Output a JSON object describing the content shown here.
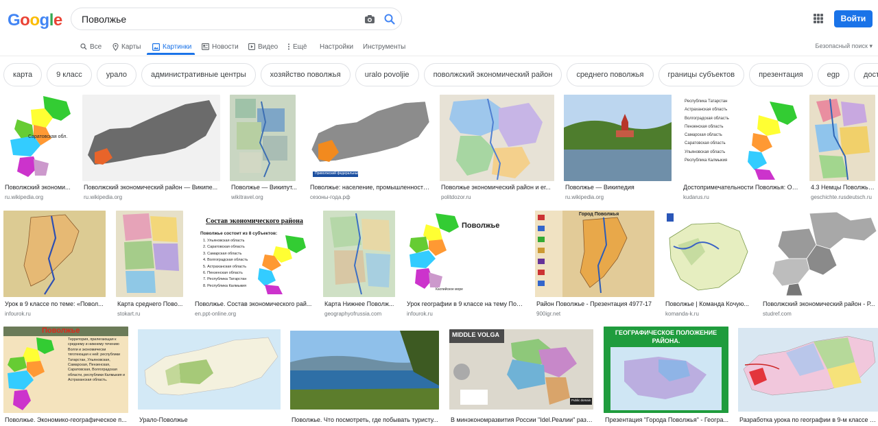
{
  "header": {
    "logo_letters": [
      "G",
      "o",
      "o",
      "g",
      "l",
      "e"
    ],
    "query": "Поволжье",
    "signin_label": "Войти"
  },
  "tabs": [
    {
      "label": "Все",
      "icon": "search-icon"
    },
    {
      "label": "Карты",
      "icon": "map-pin-icon"
    },
    {
      "label": "Картинки",
      "icon": "image-icon",
      "active": true
    },
    {
      "label": "Новости",
      "icon": "newspaper-icon"
    },
    {
      "label": "Видео",
      "icon": "play-icon"
    },
    {
      "label": "Ещё",
      "icon": "more-vert-icon"
    },
    {
      "label": "Настройки"
    },
    {
      "label": "Инструменты"
    }
  ],
  "safesearch_label": "Безопасный поиск ▾",
  "chips": [
    "карта",
    "9 класс",
    "урало",
    "административные центры",
    "хозяйство поволжья",
    "uralo povoljie",
    "поволжский экономический район",
    "среднего поволжья",
    "границы субъектов",
    "презентация",
    "egp",
    "достопримечатель"
  ],
  "results": [
    {
      "title": "Поволжский экономи...",
      "source": "ru.wikipedia.org"
    },
    {
      "title": "Поволжский экономический район — Википе...",
      "source": "ru.wikipedia.org"
    },
    {
      "title": "Поволжье — Википут...",
      "source": "wikitravel.org"
    },
    {
      "title": "Поволжье: население, промышленность...",
      "source": "сезоны-года.рф"
    },
    {
      "title": "Поволжье экономический район и ег...",
      "source": "politdozor.ru"
    },
    {
      "title": "Поволжье — Википедия",
      "source": "ru.wikipedia.org"
    },
    {
      "title": "Достопримечательности Поволжья: Ос...",
      "source": "kudarus.ru"
    },
    {
      "title": "4.3 Немцы Поволжья ...",
      "source": "geschichte.rusdeutsch.ru"
    },
    {
      "title": "Урок в 9 классе по теме: «Повол...",
      "source": "infourok.ru"
    },
    {
      "title": "Карта среднего Пово...",
      "source": "stokart.ru"
    },
    {
      "title": "Поволжье. Состав экономического рай...",
      "source": "en.ppt-online.org"
    },
    {
      "title": "Карта Нижнее Поволж...",
      "source": "geographyofrussia.com"
    },
    {
      "title": "Урок географии в 9 классе на тему Пов...",
      "source": "infourok.ru"
    },
    {
      "title": "Район Поволжье - Презентация 4977-17",
      "source": "900igr.net"
    },
    {
      "title": "Поволжье | Команда Кочую...",
      "source": "komanda-k.ru"
    },
    {
      "title": "Поволжский экономический район - Р...",
      "source": "studref.com"
    },
    {
      "title": "Поволжье. Экономико-географическое п...",
      "source": ""
    },
    {
      "title": "Урало-Поволжье",
      "source": ""
    },
    {
      "title": "Поволжье. Что посмотреть, где побывать туристу...",
      "source": ""
    },
    {
      "title": "В минэкономразвития России \"Idel.Реалии\" разъ...",
      "source": ""
    },
    {
      "title": "Презентация \"Города Поволжья\" - Геогра...",
      "source": ""
    },
    {
      "title": "Разработка урока по географии в 9-м классе п...",
      "source": ""
    }
  ],
  "image_text": {
    "map1_label": "Саратовская обл.",
    "map4_label": "Приволжский федеральный округ",
    "list_items": [
      "Республика Татарстан",
      "Астраханская область",
      "Волгоградская область",
      "Пензенская область",
      "Самарская область",
      "Саратовская область",
      "Ульяновская область",
      "Республика Калмыкия"
    ],
    "slide_title": "Состав экономического района",
    "slide_intro": "Поволжье состоит из 8 субъектов:",
    "slide_items": [
      "1. Ульяновская область",
      "2. Саратовская область",
      "3. Самарская область",
      "4. Волгоградская область",
      "5. Астраханская область",
      "6. Пензенская область",
      "7. Республика Татарстан",
      "8. Республика Калмыкия"
    ],
    "povolzhie_label": "Поволжье",
    "caspian_label": "Каспийское море",
    "cities_title": "Город Поволжья",
    "povolzhie_slide_title": "Поволжье",
    "povolzhie_slide_text": "Территория, прилегающая к среднему и нижнему течению Волги и экономически тяготеющая к ней: республики Татарстан, Ульяновская, Самарская, Пензенская, Саратовская, Волгоградская области, республики Калмыкия и Астраханская область.",
    "middle_volga": "MIDDLE VOLGA",
    "geo_title": "ГЕОГРАФИЧЕСКОЕ ПОЛОЖЕНИЕ РАЙОНА.",
    "public_domain": "Public domain"
  },
  "colors": {
    "logo": [
      "#4285f4",
      "#ea4335",
      "#fbbc05",
      "#4285f4",
      "#34a853",
      "#ea4335"
    ],
    "accent": "#1a73e8"
  }
}
